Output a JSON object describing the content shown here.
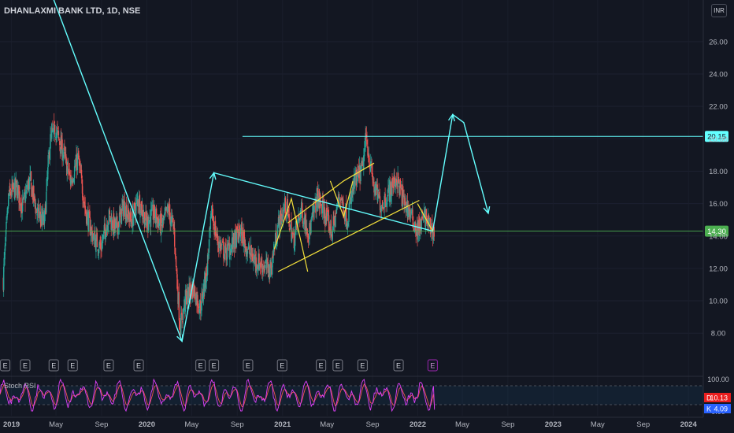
{
  "header": {
    "symbol_title": "DHANLAXMI BANK LTD, 1D, NSE",
    "currency": "INR"
  },
  "price_axis": {
    "ticks": [
      "26.00",
      "24.00",
      "22.00",
      "20.00",
      "18.00",
      "16.00",
      "14.00",
      "12.00",
      "10.00",
      "8.00"
    ],
    "ymin": 6.6,
    "ymax": 27.5
  },
  "time_axis": {
    "ticks": [
      "2019",
      "May",
      "Sep",
      "2020",
      "May",
      "Sep",
      "2021",
      "May",
      "Sep",
      "2022",
      "May",
      "Sep",
      "2023",
      "May",
      "Sep",
      "2024"
    ],
    "bold": [
      "2019",
      "2020",
      "2021",
      "2022",
      "2023",
      "2024"
    ]
  },
  "price_labels": {
    "resistance": "20.15",
    "last": "14.30"
  },
  "earnings_label": "E",
  "indicator": {
    "name": "Stoch RSI",
    "upper": "100.00",
    "lower": "0.00",
    "d_label": "D",
    "d_value": "10.13",
    "k_label": "K",
    "k_value": "4.09"
  },
  "colors": {
    "bg": "#131722",
    "up": "#26a69a",
    "down": "#ef5350",
    "cyan": "#64ffff",
    "yellow": "#f5e13b",
    "green_line": "#4caf50",
    "k_line": "#e040fb",
    "d_line": "#ef5350"
  },
  "chart_data": {
    "type": "candlestick",
    "x_range": [
      "2018-12",
      "2024-02"
    ],
    "ylim": [
      6.6,
      27.5
    ],
    "close_path": [
      [
        "2018-12-10",
        11.3
      ],
      [
        "2018-12-25",
        16.5
      ],
      [
        "2019-01-15",
        17.0
      ],
      [
        "2019-01-31",
        15.8
      ],
      [
        "2019-02-20",
        17.5
      ],
      [
        "2019-03-10",
        15.5
      ],
      [
        "2019-03-31",
        14.8
      ],
      [
        "2019-04-15",
        19.8
      ],
      [
        "2019-04-30",
        20.6
      ],
      [
        "2019-05-20",
        19.2
      ],
      [
        "2019-06-10",
        17.4
      ],
      [
        "2019-06-30",
        18.8
      ],
      [
        "2019-07-20",
        15.6
      ],
      [
        "2019-08-10",
        13.9
      ],
      [
        "2019-08-31",
        13.3
      ],
      [
        "2019-09-20",
        15.2
      ],
      [
        "2019-10-10",
        14.4
      ],
      [
        "2019-10-31",
        15.9
      ],
      [
        "2019-11-20",
        14.9
      ],
      [
        "2019-12-10",
        16.3
      ],
      [
        "2019-12-31",
        14.8
      ],
      [
        "2020-01-20",
        15.4
      ],
      [
        "2020-02-10",
        14.6
      ],
      [
        "2020-02-29",
        15.6
      ],
      [
        "2020-03-15",
        14.3
      ],
      [
        "2020-03-31",
        8.3
      ],
      [
        "2020-04-15",
        10.1
      ],
      [
        "2020-05-05",
        10.8
      ],
      [
        "2020-05-25",
        9.6
      ],
      [
        "2020-06-10",
        11.7
      ],
      [
        "2020-06-25",
        15.4
      ],
      [
        "2020-07-10",
        13.7
      ],
      [
        "2020-07-31",
        12.9
      ],
      [
        "2020-08-20",
        13.5
      ],
      [
        "2020-09-10",
        14.3
      ],
      [
        "2020-09-30",
        13.1
      ],
      [
        "2020-10-20",
        12.5
      ],
      [
        "2020-11-10",
        12.2
      ],
      [
        "2020-11-30",
        11.9
      ],
      [
        "2020-12-20",
        14.6
      ],
      [
        "2021-01-10",
        15.9
      ],
      [
        "2021-01-31",
        13.7
      ],
      [
        "2021-02-20",
        15.6
      ],
      [
        "2021-03-15",
        14.2
      ],
      [
        "2021-04-05",
        16.4
      ],
      [
        "2021-04-25",
        15.4
      ],
      [
        "2021-05-15",
        14.2
      ],
      [
        "2021-06-05",
        16.6
      ],
      [
        "2021-06-25",
        15.0
      ],
      [
        "2021-07-15",
        17.3
      ],
      [
        "2021-08-05",
        18.1
      ],
      [
        "2021-08-15",
        20.1
      ],
      [
        "2021-09-05",
        17.0
      ],
      [
        "2021-09-25",
        15.9
      ],
      [
        "2021-10-15",
        16.7
      ],
      [
        "2021-11-05",
        17.6
      ],
      [
        "2021-11-25",
        16.1
      ],
      [
        "2021-12-10",
        15.5
      ],
      [
        "2021-12-31",
        14.3
      ],
      [
        "2022-01-20",
        15.2
      ],
      [
        "2022-02-05",
        14.5
      ],
      [
        "2022-02-15",
        14.3
      ]
    ],
    "earnings_dates": [
      "2018-12-15",
      "2019-02-07",
      "2019-04-25",
      "2019-06-15",
      "2019-09-20",
      "2019-12-10",
      "2020-05-25",
      "2020-06-30",
      "2020-09-30",
      "2020-12-31",
      "2021-04-15",
      "2021-05-30",
      "2021-08-05",
      "2021-11-10",
      "2022-02-10"
    ],
    "horizontal_lines": [
      {
        "name": "resistance",
        "price": 20.15,
        "from": "2020-09-15"
      },
      {
        "name": "current-level",
        "price": 14.3,
        "from": "2018-12-01"
      }
    ],
    "cyan_projection": [
      [
        "2019-04-10",
        29.5
      ],
      [
        "2020-04-05",
        7.5
      ],
      [
        "2020-06-30",
        17.9
      ],
      [
        "2022-02-10",
        14.3
      ],
      [
        "2022-04-05",
        21.5
      ],
      [
        "2022-05-05",
        21.0
      ],
      [
        "2022-07-10",
        15.4
      ]
    ],
    "yellow_pattern": {
      "lower_trendline": [
        [
          "2020-12-20",
          11.8
        ],
        [
          "2022-01-05",
          16.2
        ]
      ],
      "upper_channel": [
        [
          "2021-01-15",
          14.8
        ],
        [
          "2021-06-15",
          17.4
        ],
        [
          "2021-09-05",
          18.5
        ]
      ],
      "zigzag_left": [
        [
          "2020-12-10",
          13.2
        ],
        [
          "2021-01-25",
          16.3
        ],
        [
          "2021-03-10",
          11.8
        ]
      ],
      "zigzag_mid": [
        [
          "2021-05-10",
          17.4
        ],
        [
          "2021-06-15",
          15.2
        ],
        [
          "2021-07-10",
          17.4
        ]
      ],
      "triangle": [
        [
          "2021-12-31",
          16.0
        ],
        [
          "2022-02-10",
          14.3
        ]
      ]
    },
    "stoch_rsi": {
      "ylim": [
        0,
        100
      ],
      "levels": [
        80,
        20
      ],
      "d_last": 10.13,
      "k_last": 4.09
    }
  }
}
